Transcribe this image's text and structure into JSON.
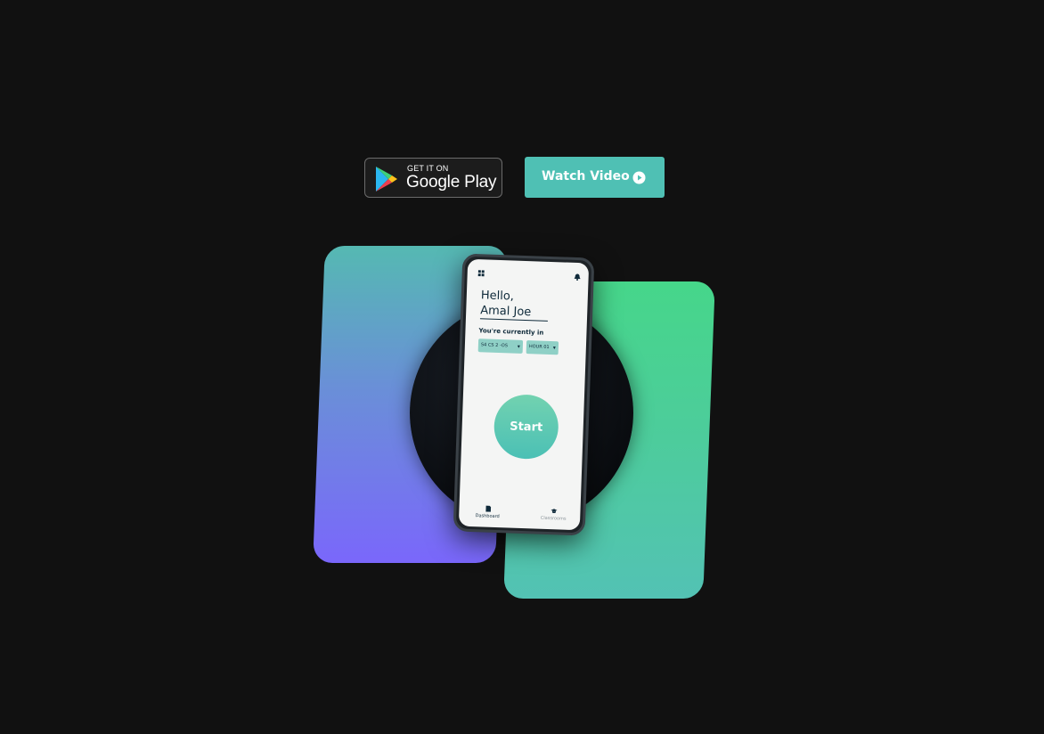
{
  "store_button": {
    "small_text": "GET IT ON",
    "big_text": "Google Play"
  },
  "watch_button": {
    "label": "Watch Video"
  },
  "phone": {
    "greeting_line1": "Hello,",
    "greeting_line2": "Amal Joe",
    "currently_label": "You're currently in",
    "class_select": "S4 CS 2 -OS",
    "hour_select": "HOUR 01",
    "start_label": "Start",
    "nav": {
      "dashboard": "Dashboard",
      "classrooms": "Classrooms"
    }
  },
  "icons": {
    "store": "google-play-icon",
    "play": "play-circle-icon",
    "menu": "grid-icon",
    "bell": "bell-icon",
    "dashboard": "document-icon",
    "classrooms": "graduation-cap-icon"
  },
  "colors": {
    "accent": "#4fc0b4",
    "card_left_bottom": "#7a67fb",
    "card_right_top": "#46d68a",
    "background": "#111111"
  }
}
